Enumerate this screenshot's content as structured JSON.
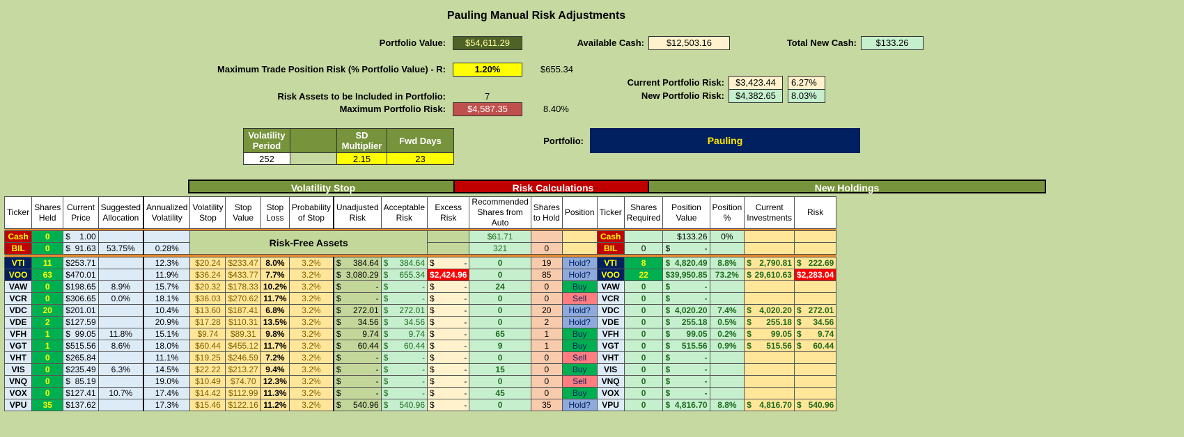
{
  "title": "Pauling Manual Risk Adjustments",
  "portfolio_value": {
    "label": "Portfolio Value:",
    "value": "$54,611.29"
  },
  "available_cash": {
    "label": "Available Cash:",
    "value": "$12,503.16"
  },
  "total_new_cash": {
    "label": "Total New Cash:",
    "value": "$133.26"
  },
  "max_trade_risk": {
    "label": "Maximum Trade Position Risk (% Portfolio Value) - R:",
    "value": "1.20%",
    "amount": "$655.34"
  },
  "current_risk": {
    "label": "Current Portfolio Risk:",
    "value": "$3,423.44",
    "pct": "6.27%"
  },
  "new_risk": {
    "label": "New Portfolio Risk:",
    "value": "$4,382.65",
    "pct": "8.03%"
  },
  "risk_assets": {
    "label": "Risk Assets to be Included in Portfolio:",
    "value": "7"
  },
  "max_portfolio_risk": {
    "label": "Maximum Portfolio Risk:",
    "value": "$4,587.35",
    "pct": "8.40%"
  },
  "vol_params": {
    "headers": [
      "Volatility Period",
      "",
      "SD Multiplier",
      "Fwd Days"
    ],
    "values": [
      "252",
      "",
      "2.15",
      "23"
    ]
  },
  "portfolio": {
    "label": "Portfolio:",
    "name": "Pauling"
  },
  "sections": {
    "vol_stop": "Volatility Stop",
    "risk_calc": "Risk Calculations",
    "new_holdings": "New Holdings"
  },
  "headers": [
    "Ticker",
    "Shares Held",
    "Current Price",
    "Suggested Allocation",
    "Annualized Volatility",
    "Volatility Stop",
    "Stop Value",
    "Stop Loss",
    "Probability of Stop",
    "Unadjusted Risk",
    "Acceptable Risk",
    "Excess Risk",
    "Recommended Shares from Auto",
    "Shares to Hold",
    "Position",
    "Ticker",
    "Shares Required",
    "Position Value",
    "Position %",
    "Current Investments",
    "Risk"
  ],
  "risk_free_label": "Risk-Free Assets",
  "cash_row": {
    "ticker": "Cash",
    "held": "0",
    "price": "1.00",
    "rec": "$61.71",
    "ticker2": "Cash",
    "posval": "$133.26",
    "pospct": "0%"
  },
  "bil_row": {
    "ticker": "BIL",
    "held": "0",
    "price": "91.63",
    "alloc": "53.75%",
    "vol": "0.28%",
    "rec": "321",
    "hold": "0",
    "ticker2": "BIL",
    "req": "0",
    "posval": "-"
  },
  "rows": [
    {
      "t": "VTI",
      "held": "11",
      "price": "253.71",
      "alloc": "",
      "vol": "12.3%",
      "vstop": "$20.24",
      "sval": "$233.47",
      "sloss": "8.0%",
      "prob": "3.2%",
      "unadj": "384.64",
      "acc": "384.64",
      "exc": "-",
      "rec": "0",
      "hold": "19",
      "pos": "Hold?",
      "req": "8",
      "pval": "4,820.49",
      "ppct": "8.8%",
      "cur": "2,790.81",
      "risk": "222.69"
    },
    {
      "t": "VOO",
      "held": "63",
      "price": "470.01",
      "alloc": "",
      "vol": "11.9%",
      "vstop": "$36.24",
      "sval": "$433.77",
      "sloss": "7.7%",
      "prob": "3.2%",
      "unadj": "3,080.29",
      "acc": "655.34",
      "exc": "2,424.96",
      "rec": "0",
      "hold": "85",
      "pos": "Hold?",
      "req": "22",
      "pval": "39,950.85",
      "ppct": "73.2%",
      "cur": "29,610.63",
      "risk": "2,283.04"
    },
    {
      "t": "VAW",
      "held": "0",
      "price": "198.65",
      "alloc": "8.9%",
      "vol": "15.7%",
      "vstop": "$20.32",
      "sval": "$178.33",
      "sloss": "10.2%",
      "prob": "3.2%",
      "unadj": "-",
      "acc": "-",
      "exc": "-",
      "rec": "24",
      "hold": "0",
      "pos": "Buy",
      "req": "0",
      "pval": "-",
      "ppct": "",
      "cur": "",
      "risk": ""
    },
    {
      "t": "VCR",
      "held": "0",
      "price": "306.65",
      "alloc": "0.0%",
      "vol": "18.1%",
      "vstop": "$36.03",
      "sval": "$270.62",
      "sloss": "11.7%",
      "prob": "3.2%",
      "unadj": "-",
      "acc": "-",
      "exc": "-",
      "rec": "0",
      "hold": "0",
      "pos": "Sell",
      "req": "0",
      "pval": "-",
      "ppct": "",
      "cur": "",
      "risk": ""
    },
    {
      "t": "VDC",
      "held": "20",
      "price": "201.01",
      "alloc": "",
      "vol": "10.4%",
      "vstop": "$13.60",
      "sval": "$187.41",
      "sloss": "6.8%",
      "prob": "3.2%",
      "unadj": "272.01",
      "acc": "272.01",
      "exc": "-",
      "rec": "0",
      "hold": "20",
      "pos": "Hold?",
      "req": "0",
      "pval": "4,020.20",
      "ppct": "7.4%",
      "cur": "4,020.20",
      "risk": "272.01"
    },
    {
      "t": "VDE",
      "held": "2",
      "price": "127.59",
      "alloc": "",
      "vol": "20.9%",
      "vstop": "$17.28",
      "sval": "$110.31",
      "sloss": "13.5%",
      "prob": "3.2%",
      "unadj": "34.56",
      "acc": "34.56",
      "exc": "-",
      "rec": "0",
      "hold": "2",
      "pos": "Hold?",
      "req": "0",
      "pval": "255.18",
      "ppct": "0.5%",
      "cur": "255.18",
      "risk": "34.56"
    },
    {
      "t": "VFH",
      "held": "1",
      "price": "99.05",
      "alloc": "11.8%",
      "vol": "15.1%",
      "vstop": "$9.74",
      "sval": "$89.31",
      "sloss": "9.8%",
      "prob": "3.2%",
      "unadj": "9.74",
      "acc": "9.74",
      "exc": "-",
      "rec": "65",
      "hold": "1",
      "pos": "Buy",
      "req": "0",
      "pval": "99.05",
      "ppct": "0.2%",
      "cur": "99.05",
      "risk": "9.74"
    },
    {
      "t": "VGT",
      "held": "1",
      "price": "515.56",
      "alloc": "8.6%",
      "vol": "18.0%",
      "vstop": "$60.44",
      "sval": "$455.12",
      "sloss": "11.7%",
      "prob": "3.2%",
      "unadj": "60.44",
      "acc": "60.44",
      "exc": "-",
      "rec": "9",
      "hold": "1",
      "pos": "Buy",
      "req": "0",
      "pval": "515.56",
      "ppct": "0.9%",
      "cur": "515.56",
      "risk": "60.44"
    },
    {
      "t": "VHT",
      "held": "0",
      "price": "265.84",
      "alloc": "",
      "vol": "11.1%",
      "vstop": "$19.25",
      "sval": "$246.59",
      "sloss": "7.2%",
      "prob": "3.2%",
      "unadj": "-",
      "acc": "-",
      "exc": "-",
      "rec": "0",
      "hold": "0",
      "pos": "Sell",
      "req": "0",
      "pval": "-",
      "ppct": "",
      "cur": "",
      "risk": ""
    },
    {
      "t": "VIS",
      "held": "0",
      "price": "235.49",
      "alloc": "6.3%",
      "vol": "14.5%",
      "vstop": "$22.22",
      "sval": "$213.27",
      "sloss": "9.4%",
      "prob": "3.2%",
      "unadj": "-",
      "acc": "-",
      "exc": "-",
      "rec": "15",
      "hold": "0",
      "pos": "Buy",
      "req": "0",
      "pval": "-",
      "ppct": "",
      "cur": "",
      "risk": ""
    },
    {
      "t": "VNQ",
      "held": "0",
      "price": "85.19",
      "alloc": "",
      "vol": "19.0%",
      "vstop": "$10.49",
      "sval": "$74.70",
      "sloss": "12.3%",
      "prob": "3.2%",
      "unadj": "-",
      "acc": "-",
      "exc": "-",
      "rec": "0",
      "hold": "0",
      "pos": "Sell",
      "req": "0",
      "pval": "-",
      "ppct": "",
      "cur": "",
      "risk": ""
    },
    {
      "t": "VOX",
      "held": "0",
      "price": "127.41",
      "alloc": "10.7%",
      "vol": "17.4%",
      "vstop": "$14.42",
      "sval": "$112.99",
      "sloss": "11.3%",
      "prob": "3.2%",
      "unadj": "-",
      "acc": "-",
      "exc": "-",
      "rec": "45",
      "hold": "0",
      "pos": "Buy",
      "req": "0",
      "pval": "-",
      "ppct": "",
      "cur": "",
      "risk": ""
    },
    {
      "t": "VPU",
      "held": "35",
      "price": "137.62",
      "alloc": "",
      "vol": "17.3%",
      "vstop": "$15.46",
      "sval": "$122.16",
      "sloss": "11.2%",
      "prob": "3.2%",
      "unadj": "540.96",
      "acc": "540.96",
      "exc": "-",
      "rec": "0",
      "hold": "35",
      "pos": "Hold?",
      "req": "0",
      "pval": "4,816.70",
      "ppct": "8.8%",
      "cur": "4,816.70",
      "risk": "540.96"
    }
  ],
  "colors": {
    "bg": "#c5d9a0",
    "navy": "#002060",
    "olive": "#77933c",
    "red": "#c00000",
    "buy": "#00b050",
    "sell": "#ff7c80",
    "hold": "#8ea9db"
  }
}
